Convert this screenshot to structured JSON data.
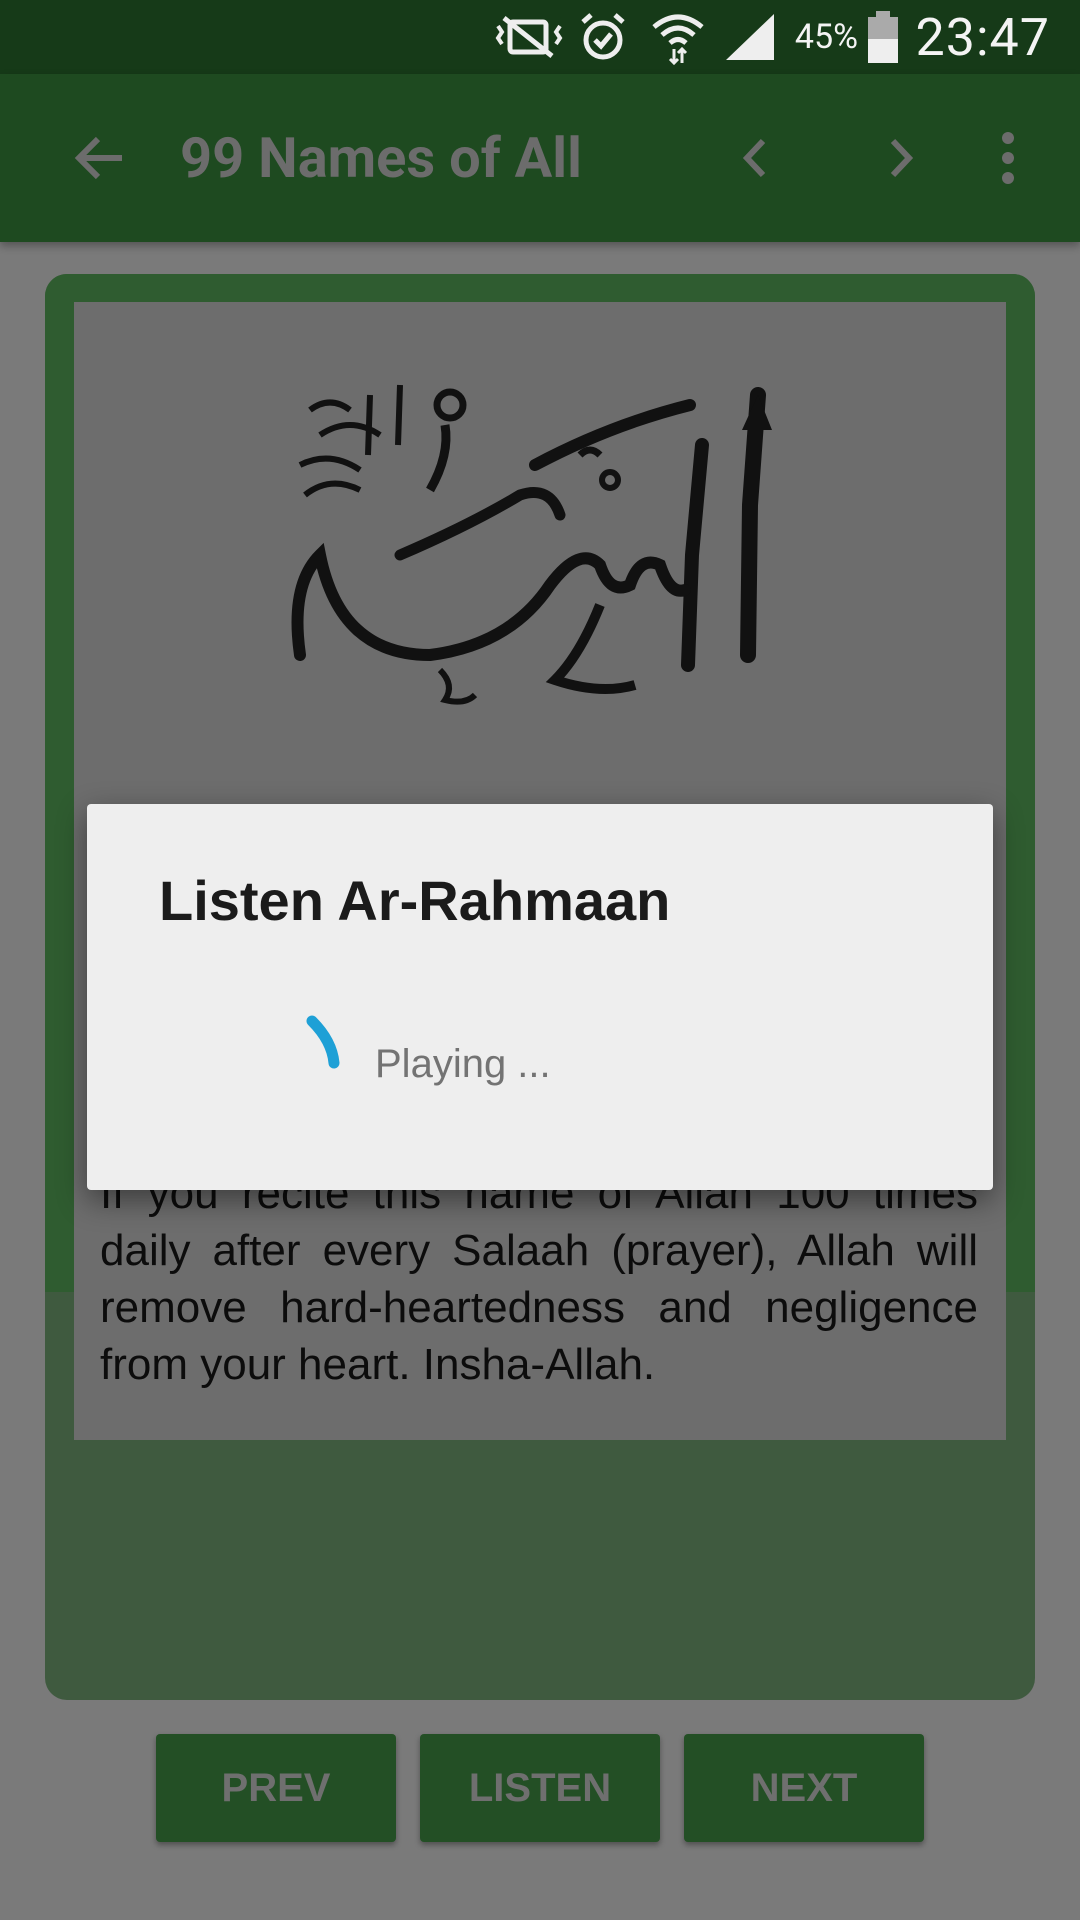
{
  "status_bar": {
    "battery_percent": "45%",
    "time": "23:47",
    "icons": [
      "mute-vibrate-icon",
      "alarm-icon",
      "wifi-icon",
      "signal-icon",
      "battery-icon"
    ]
  },
  "app_bar": {
    "title": "99 Names of All",
    "icons": [
      "back-arrow-icon",
      "chevron-left-icon",
      "chevron-right-icon",
      "more-vert-icon"
    ]
  },
  "content": {
    "calligraphy_icon": "arabic-calligraphy-image",
    "description": "If you recite this name of Allah 100 times daily after every Salaah (prayer), Allah will remove hard-heartedness and negligence from your heart. Insha-Allah."
  },
  "buttons": {
    "prev": "PREV",
    "listen": "LISTEN",
    "next": "NEXT"
  },
  "dialog": {
    "title": "Listen Ar-Rahmaan",
    "message": "Playing ..."
  },
  "colors": {
    "primary": "#2e7d32",
    "spinner": "#1ea0d6"
  }
}
